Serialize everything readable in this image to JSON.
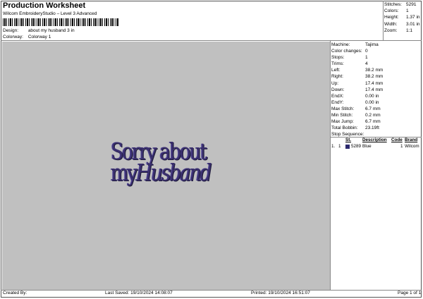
{
  "header": {
    "title": "Production Worksheet",
    "subtitle": "Wilcom EmbroideryStudio – Level 3 Advanced",
    "design_label": "Design:",
    "design_value": "about my husband 3 in",
    "colorway_label": "Colorway:",
    "colorway_value": "Colorway 1"
  },
  "stats": [
    {
      "label": "Stitches:",
      "value": "5291"
    },
    {
      "label": "Colors:",
      "value": "1"
    },
    {
      "label": "Height:",
      "value": "1.37 in"
    },
    {
      "label": "Width:",
      "value": "3.01 in"
    },
    {
      "label": "Zoom:",
      "value": "1:1"
    }
  ],
  "design_text": {
    "line1": "Sorry about",
    "line2a": "my",
    "line2b": "Husband",
    "thread_color": "#3a2f6e"
  },
  "machine": [
    {
      "label": "Machine:",
      "value": "Tajima"
    },
    {
      "label": "Color changes:",
      "value": "0"
    },
    {
      "label": "Stops:",
      "value": "1"
    },
    {
      "label": "Trims:",
      "value": "4"
    },
    {
      "label": "Left:",
      "value": "38.2 mm"
    },
    {
      "label": "Right:",
      "value": "38.2 mm"
    },
    {
      "label": "Up:",
      "value": "17.4 mm"
    },
    {
      "label": "Down:",
      "value": "17.4 mm"
    },
    {
      "label": "EndX:",
      "value": "0.00 in"
    },
    {
      "label": "EndY:",
      "value": "0.00 in"
    },
    {
      "label": "Max Stitch:",
      "value": "6.7 mm"
    },
    {
      "label": "Min Stitch:",
      "value": "0.2 mm"
    },
    {
      "label": "Max Jump:",
      "value": "6.7 mm"
    },
    {
      "label": "Total Bobbin:",
      "value": "23.19ft"
    }
  ],
  "stop_sequence": {
    "title": "Stop Sequence:",
    "headers": {
      "st": "St.",
      "description": "Description",
      "code": "Code",
      "brand": "Brand"
    },
    "rows": [
      {
        "idx": "1.",
        "num": "1",
        "st": "5289",
        "description": "Blue",
        "code": "1",
        "brand": "Wilcom",
        "swatch": "#2c2a6e"
      }
    ]
  },
  "footer": {
    "created": "Created By:",
    "saved": "Last Saved: 19/10/2024 14:08:07",
    "printed": "Printed: 19/10/2024 16:51:07",
    "page": "Page 1 of 1"
  }
}
